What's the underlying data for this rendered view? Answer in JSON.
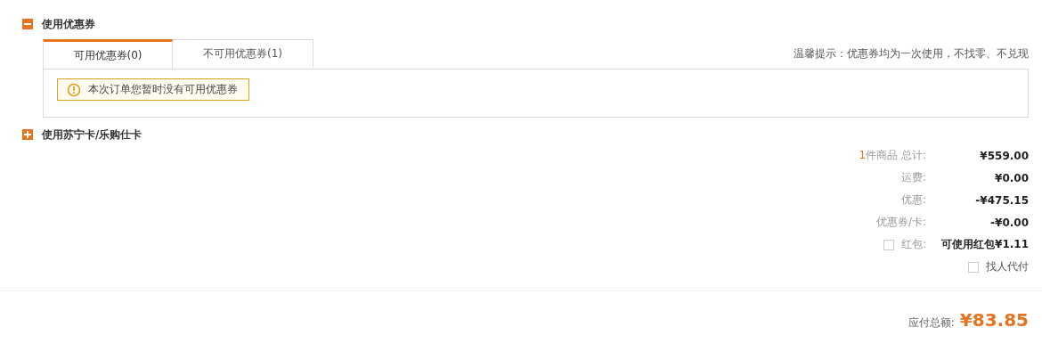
{
  "coupon_section": {
    "title": "使用优惠券",
    "expanded": true,
    "tabs": [
      {
        "label": "可用优惠券(0)",
        "selected": true
      },
      {
        "label": "不可用优惠券(1)",
        "selected": false
      }
    ],
    "tip": "温馨提示：优惠券均为一次使用，不找零、不兑现",
    "notice": "本次订单您暂时没有可用优惠券"
  },
  "card_section": {
    "title": "使用苏宁卡/乐购仕卡",
    "expanded": false
  },
  "summary": [
    {
      "kind": "count",
      "count": "1",
      "label": "件商品 总计:",
      "value": "¥559.00"
    },
    {
      "kind": "plain",
      "label": "运费:",
      "value": "¥0.00"
    },
    {
      "kind": "plain",
      "label": "优惠:",
      "value": "-¥475.15"
    },
    {
      "kind": "plain",
      "label": "优惠券/卡:",
      "value": "-¥0.00"
    },
    {
      "kind": "checkbox",
      "checked": false,
      "label": "红包:",
      "value": "可使用红包¥1.11"
    }
  ],
  "pay_for_me": {
    "label": "找人代付",
    "checked": false
  },
  "total": {
    "label": "应付总额:",
    "value": "¥83.85"
  }
}
